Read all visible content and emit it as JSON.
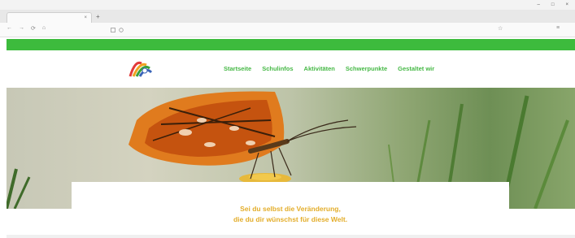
{
  "browser": {
    "menu_items": [
      "",
      "",
      "",
      "",
      "",
      "",
      "",
      ""
    ],
    "window_controls": [
      "–",
      "□",
      "×"
    ],
    "tab": {
      "title": "",
      "close": "×",
      "new_tab": "+"
    },
    "nav": {
      "back": "←",
      "forward": "→",
      "reload": "⟳",
      "home": "⌂"
    },
    "url": "",
    "star": "☆",
    "menu": "≡"
  },
  "site": {
    "logo": {
      "line1": "",
      "line2": ""
    },
    "nav": [
      "Startseite",
      "Schulinfos",
      "Aktivitäten",
      "Schwerpunkte",
      "Gestaltet wir"
    ],
    "quote": {
      "line1": "Sei du selbst die Veränderung,",
      "line2": "die du dir wünschst für diese Welt.",
      "author": ""
    }
  },
  "colors": {
    "brand_green": "#3dbb3d",
    "nav_green": "#45b845",
    "quote_yellow": "#e3ad2a",
    "logo_red": "#d84848",
    "logo_blue": "#3a64b8"
  }
}
